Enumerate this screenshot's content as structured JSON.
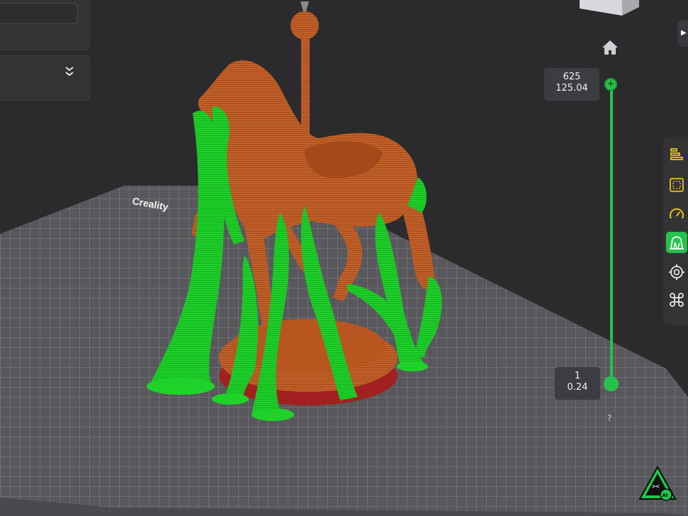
{
  "viewport": {
    "bed_brand": "Creality"
  },
  "layer_slider": {
    "top": {
      "layer": "625",
      "height": "125.04"
    },
    "bottom": {
      "layer": "1",
      "height": "0.24"
    },
    "top_handle_symbol": "+"
  },
  "help": {
    "label": "?"
  },
  "toolbar": {
    "tools": [
      {
        "icon": "layers-align-icon",
        "active": false
      },
      {
        "icon": "dotted-square-icon",
        "active": false
      },
      {
        "icon": "speedometer-icon",
        "active": false
      },
      {
        "icon": "support-paint-icon",
        "active": true
      },
      {
        "icon": "target-icon",
        "active": false
      },
      {
        "icon": "command-icon",
        "active": false
      }
    ]
  },
  "colors": {
    "accent": "#27c24c",
    "tool_icon": "#e8c31a",
    "model": "#c4612a",
    "support": "#1fd22a",
    "background": "#2b2b2d"
  },
  "assistant": {
    "icon": "ai-assistant-icon",
    "badge": "AI"
  }
}
